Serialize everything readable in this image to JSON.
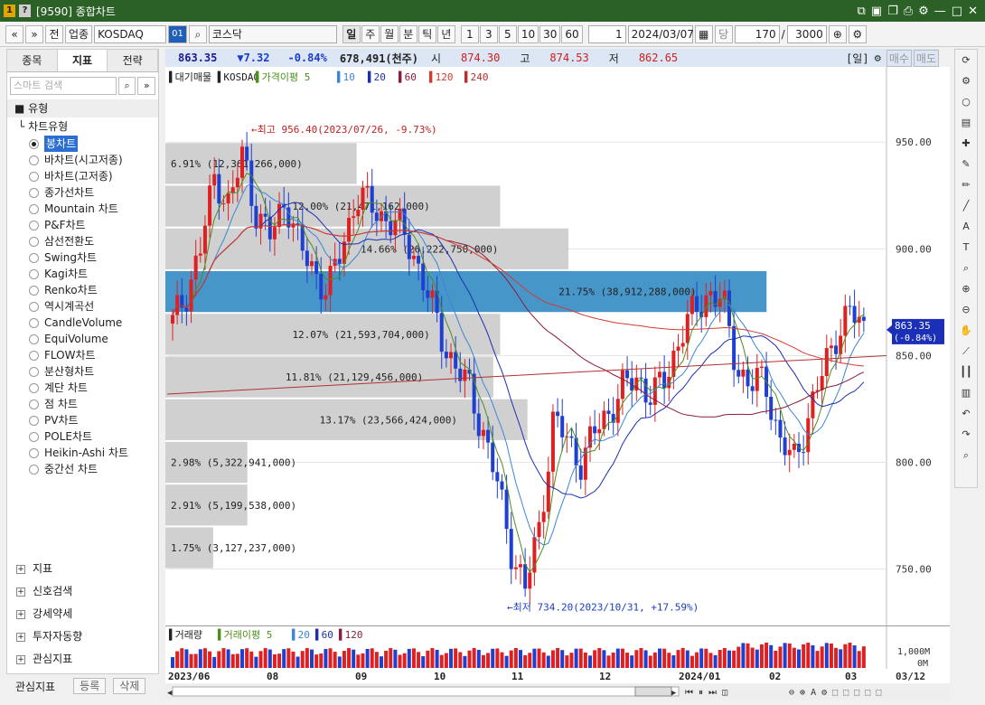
{
  "window": {
    "title": "[9590] 종합차트",
    "icon_1": "1",
    "icon_2": "?"
  },
  "toolbar": {
    "prev": "«",
    "next": "»",
    "jeon": "전",
    "sector_label": "업종",
    "sector_code": "KOSDAQ",
    "code_badge": "01",
    "name": "코스닥",
    "periods": [
      "일",
      "주",
      "월",
      "분",
      "틱",
      "년"
    ],
    "nums": [
      "1",
      "3",
      "5",
      "10",
      "30",
      "60"
    ],
    "period_count": "1",
    "date": "2024/03/07",
    "dang": "당",
    "count": "170",
    "slash": "/",
    "total": "3000"
  },
  "left": {
    "tabs": [
      "종목",
      "지표",
      "전략"
    ],
    "search_placeholder": "스마트 검색",
    "section": "유형",
    "subsection": "차트유형",
    "chart_types": [
      "봉차트",
      "바차트(시고저종)",
      "바차트(고저종)",
      "종가선차트",
      "Mountain 차트",
      "P&F차트",
      "삼선전환도",
      "Swing차트",
      "Kagi차트",
      "Renko차트",
      "역시계곡선",
      "CandleVolume",
      "EquiVolume",
      "FLOW차트",
      "분산형차트",
      "계단 차트",
      "점 차트",
      "PV차트",
      "POLE차트",
      "Heikin-Ashi 차트",
      "중간선 차트"
    ],
    "bottom_sections": [
      "지표",
      "신호검색",
      "강세약세",
      "투자자동향",
      "관심지표"
    ],
    "footer": {
      "label": "관심지표",
      "register": "등록",
      "delete": "삭제"
    }
  },
  "quote": {
    "price": "863.35",
    "change": "▼7.32",
    "change_pct": "-0.84%",
    "volume": "678,491(천주)",
    "open_label": "시",
    "open": "874.30",
    "high_label": "고",
    "high": "874.53",
    "low_label": "저",
    "low": "862.65",
    "period_tag": "[일]",
    "buy": "매수",
    "sell": "매도"
  },
  "legend": {
    "title": "▌대기매물 ▌KOSDAQ",
    "ma_label": "▌가격이평 5",
    "ma": [
      "10",
      "20",
      "60",
      "120",
      "240"
    ]
  },
  "chart_data": {
    "type": "candlestick",
    "y_ticks": [
      "950.00",
      "900.00",
      "850.00",
      "800.00",
      "750.00"
    ],
    "y_tick_values": [
      950,
      900,
      850,
      800,
      750
    ],
    "ylim": [
      727,
      981
    ],
    "last_price_label": [
      "863.35",
      "(-0.84%)"
    ],
    "x_ticks": [
      "2023/06",
      "08",
      "09",
      "10",
      "11",
      "12",
      "2024/01",
      "02",
      "03"
    ],
    "x_right_label": "03/12",
    "annotations": {
      "high": "←최고 956.40(2023/07/26, -9.73%)",
      "low": "←최저 734.20(2023/10/31, +17.59%)"
    },
    "price_zones": [
      {
        "band": [
          930,
          950
        ],
        "pct": "6.91%",
        "vol": "(12,361,266,000)",
        "share": 0.28
      },
      {
        "band": [
          910,
          930
        ],
        "pct": "12.00%",
        "vol": "(21,471,162,000)",
        "share": 0.49
      },
      {
        "band": [
          890,
          910
        ],
        "pct": "14.66%",
        "vol": "(26,222,750,000)",
        "share": 0.59
      },
      {
        "band": [
          870,
          890
        ],
        "pct": "21.75%",
        "vol": "(38,912,288,000)",
        "share": 0.88,
        "highlight": true
      },
      {
        "band": [
          850,
          870
        ],
        "pct": "12.07%",
        "vol": "(21,593,704,000)",
        "share": 0.49
      },
      {
        "band": [
          830,
          850
        ],
        "pct": "11.81%",
        "vol": "(21,129,456,000)",
        "share": 0.48
      },
      {
        "band": [
          810,
          830
        ],
        "pct": "13.17%",
        "vol": "(23,566,424,000)",
        "share": 0.53
      },
      {
        "band": [
          790,
          810
        ],
        "pct": "2.98%",
        "vol": "(5,322,941,000)",
        "share": 0.12
      },
      {
        "band": [
          770,
          790
        ],
        "pct": "2.91%",
        "vol": "(5,199,538,000)",
        "share": 0.12
      },
      {
        "band": [
          750,
          770
        ],
        "pct": "1.75%",
        "vol": "(3,127,237,000)",
        "share": 0.07
      }
    ],
    "ma_colors": {
      "ma5": "#4c8f1b",
      "ma10": "#3b86d6",
      "ma20": "#1c2fb0",
      "ma60": "#8a1c3c",
      "ma120": "#d23b2e",
      "ma240": "#b33030"
    },
    "up_color": "#e02020",
    "down_color": "#1f3fd0",
    "close_path": [
      865,
      880,
      900,
      935,
      920,
      945,
      915,
      905,
      925,
      900,
      890,
      880,
      900,
      925,
      920,
      915,
      910,
      900,
      880,
      860,
      845,
      835,
      815,
      790,
      760,
      740,
      770,
      820,
      810,
      800,
      815,
      825,
      835,
      840,
      830,
      840,
      860,
      870,
      880,
      875,
      845,
      835,
      840,
      810,
      800,
      820,
      840,
      860,
      870,
      863
    ]
  },
  "volume": {
    "title": "▌거래량",
    "ma_label": "▌거래이평 5",
    "ma": [
      "20",
      "60",
      "120"
    ],
    "ticks": [
      "1,000M",
      "0M"
    ]
  },
  "icons": [
    "refresh-icon",
    "gear-icon",
    "circle-icon",
    "chart-icon",
    "crosshair-icon",
    "pencil-icon",
    "pen-icon",
    "line-icon",
    "auto-icon",
    "text-icon",
    "zoom-icon",
    "zoom-in-icon",
    "zoom-out-icon",
    "hand-icon",
    "zigzag-icon",
    "bars-icon",
    "grid-icon",
    "undo-icon",
    "redo-icon",
    "search-icon"
  ]
}
